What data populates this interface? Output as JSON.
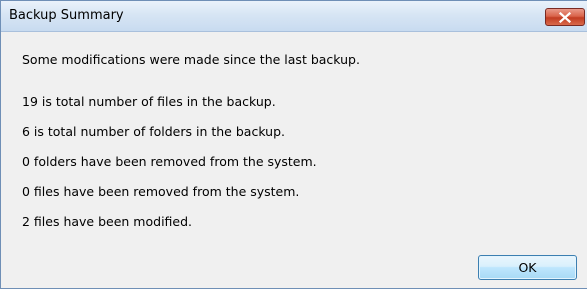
{
  "window": {
    "title": "Backup Summary"
  },
  "messages": {
    "headline": "Some modifications were made since the last backup.",
    "total_files": "19 is total number of files in the backup.",
    "total_folders": "6 is total number of folders in the backup.",
    "folders_removed": "0 folders have been removed from the system.",
    "files_removed": "0 files have been removed from the system.",
    "files_modified": "2 files have been modified."
  },
  "buttons": {
    "ok_label": "OK"
  },
  "icons": {
    "close": "close-icon"
  },
  "colors": {
    "close_button": "#c94a33",
    "ok_border": "#3c7fb1",
    "title_bar": "#d7e5f4"
  }
}
